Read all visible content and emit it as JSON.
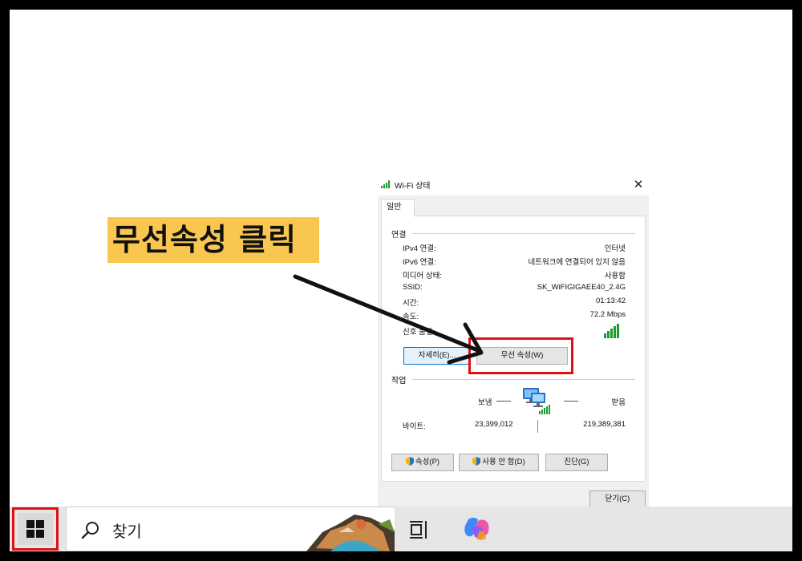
{
  "annotation": {
    "text": "무선속성 클릭"
  },
  "dialog": {
    "title": "Wi-Fi 상태",
    "close_glyph": "✕",
    "tab_label": "일반",
    "connection_section": "연결",
    "rows": [
      {
        "label": "IPv4 연결:",
        "value": "인터넷"
      },
      {
        "label": "IPv6 연결:",
        "value": "네트워크에 연결되어 있지 않음"
      },
      {
        "label": "미디어 상태:",
        "value": "사용함"
      },
      {
        "label": "SSID:",
        "value": "SK_WiFIGIGAEE40_2.4G"
      },
      {
        "label": "시간:",
        "value": "01:13:42"
      },
      {
        "label": "속도:",
        "value": "72.2 Mbps"
      },
      {
        "label": "신호 품질:",
        "value": ""
      }
    ],
    "details_button": "자세히(E)...",
    "wireless_props_button": "무선 속성(W)",
    "activity_section": "작업",
    "sent_label": "보냄",
    "received_label": "받음",
    "bytes_label": "바이트:",
    "bytes_sent": "23,399,012",
    "bytes_received": "219,389,381",
    "properties_button": "속성(P)",
    "disable_button": "사용 안 함(D)",
    "diagnose_button": "진단(G)",
    "close_button": "닫기(C)"
  },
  "taskbar": {
    "search_text": "찾기",
    "icons": [
      "windows-start-icon",
      "search-icon",
      "widgets-icon",
      "task-view-icon",
      "copilot-icon"
    ]
  },
  "colors": {
    "annotation_bg": "#f9c74f",
    "highlight": "#e01010",
    "signal": "#1e9a2e"
  }
}
